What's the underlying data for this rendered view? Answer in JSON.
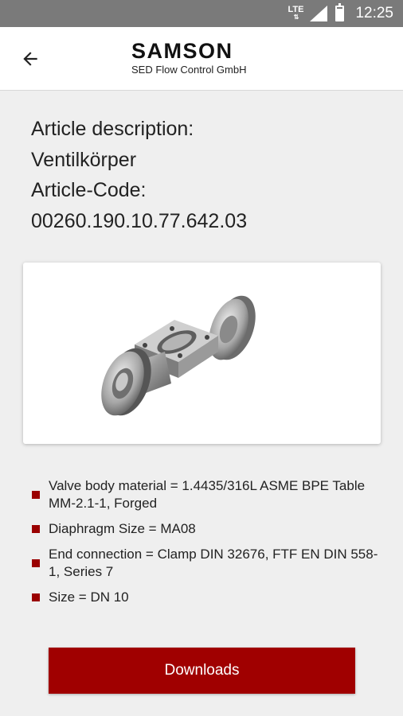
{
  "status_bar": {
    "network": "LTE",
    "time": "12:25",
    "battery_level": 0.85
  },
  "header": {
    "logo_main": "SAMSON",
    "logo_sub": "SED Flow Control GmbH",
    "back_icon": "arrow-left-icon"
  },
  "article": {
    "description_label": "Article description:",
    "description_value": "Ventilkörper",
    "code_label": "Article-Code:",
    "code_value": "00260.190.10.77.642.03"
  },
  "specs": [
    "Valve body material = 1.4435/316L ASME BPE Table MM-2.1-1, Forged",
    "Diaphragm Size = MA08",
    "End connection = Clamp DIN 32676, FTF EN DIN 558-1, Series 7",
    "Size = DN 10"
  ],
  "downloads_label": "Downloads",
  "colors": {
    "accent": "#a00000",
    "bullet": "#9a0000",
    "status_bar": "#7a7a7a",
    "background": "#efefef"
  }
}
